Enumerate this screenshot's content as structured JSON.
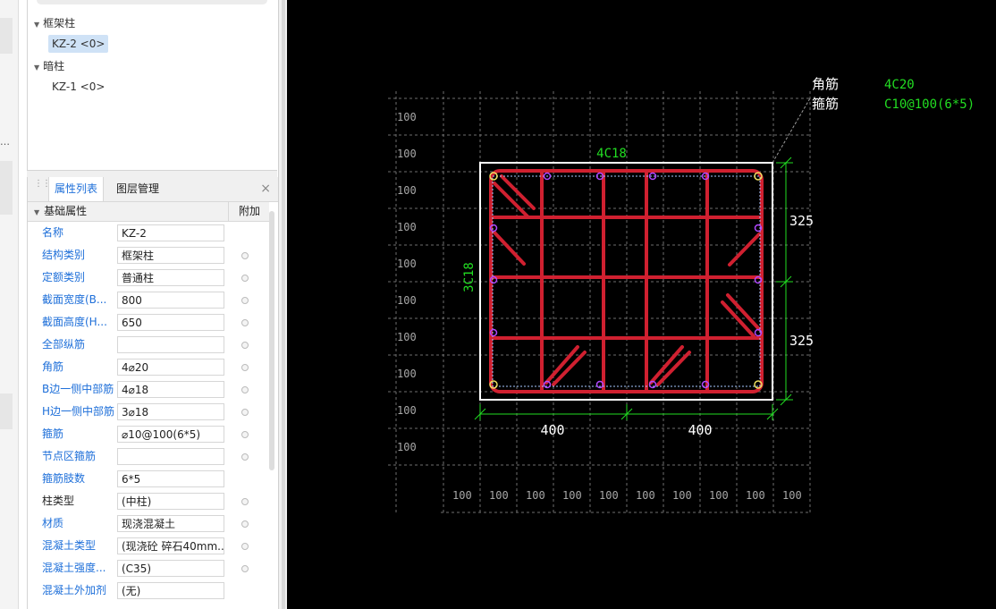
{
  "tree": {
    "groups": [
      {
        "label": "框架柱",
        "items": [
          {
            "label": "KZ-2 <0>",
            "selected": true
          }
        ]
      },
      {
        "label": "暗柱",
        "items": [
          {
            "label": "KZ-1 <0>",
            "selected": false
          }
        ]
      }
    ]
  },
  "tabs": {
    "properties": "属性列表",
    "layers": "图层管理",
    "close": "×"
  },
  "grid": {
    "section": "基础属性",
    "extra_header": "附加"
  },
  "properties": [
    {
      "label": "名称",
      "value": "KZ-2",
      "blue": true,
      "radio": false
    },
    {
      "label": "结构类别",
      "value": "框架柱",
      "blue": true,
      "radio": true
    },
    {
      "label": "定额类别",
      "value": "普通柱",
      "blue": true,
      "radio": true
    },
    {
      "label": "截面宽度(B...",
      "value": "800",
      "blue": true,
      "radio": true
    },
    {
      "label": "截面高度(H...",
      "value": "650",
      "blue": true,
      "radio": true
    },
    {
      "label": "全部纵筋",
      "value": "",
      "blue": true,
      "radio": true
    },
    {
      "label": "角筋",
      "value": "4⌀20",
      "blue": true,
      "radio": true
    },
    {
      "label": "B边一侧中部筋",
      "value": "4⌀18",
      "blue": true,
      "radio": true
    },
    {
      "label": "H边一侧中部筋",
      "value": "3⌀18",
      "blue": true,
      "radio": true
    },
    {
      "label": "箍筋",
      "value": "⌀10@100(6*5)",
      "blue": true,
      "radio": true
    },
    {
      "label": "节点区箍筋",
      "value": "",
      "blue": true,
      "radio": true
    },
    {
      "label": "箍筋肢数",
      "value": "6*5",
      "blue": true,
      "radio": false
    },
    {
      "label": "柱类型",
      "value": "(中柱)",
      "blue": false,
      "radio": true
    },
    {
      "label": "材质",
      "value": "现浇混凝土",
      "blue": true,
      "radio": true
    },
    {
      "label": "混凝土类型",
      "value": "(现浇砼 碎石40mm...",
      "blue": true,
      "radio": true
    },
    {
      "label": "混凝土强度...",
      "value": "(C35)",
      "blue": true,
      "radio": true
    },
    {
      "label": "混凝土外加剂",
      "value": "(无)",
      "blue": true,
      "radio": false
    }
  ],
  "sidebar_fragment": "…",
  "drawing": {
    "grid_label": "100",
    "corner_rebar_label": "角筋",
    "corner_rebar_value": "4C20",
    "stirrup_label": "箍筋",
    "stirrup_value": "C10@100(6*5)",
    "top_rebar": "4C18",
    "side_rebar": "3C18",
    "dim_right_upper": "325",
    "dim_right_lower": "325",
    "dim_bottom_left": "400",
    "dim_bottom_right": "400",
    "colors": {
      "background": "#000000",
      "rebar": "#d02030",
      "annotation": "#22dd22",
      "outline": "#ffffff",
      "grid": "#7a7a7a",
      "tie_points": "#b048ff"
    }
  }
}
